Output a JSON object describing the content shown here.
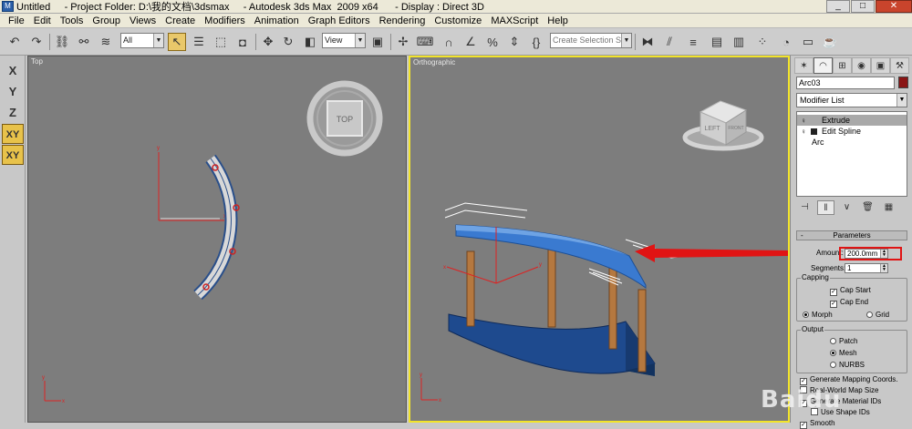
{
  "window": {
    "title": "Untitled     - Project Folder: D:\\我的文档\\3dsmax     - Autodesk 3ds Max  2009 x64      - Display : Direct 3D",
    "min": "_",
    "max": "□",
    "close": "✕"
  },
  "menu": [
    "File",
    "Edit",
    "Tools",
    "Group",
    "Views",
    "Create",
    "Modifiers",
    "Animation",
    "Graph Editors",
    "Rendering",
    "Customize",
    "MAXScript",
    "Help"
  ],
  "toolbar": {
    "filter_value": "All",
    "refcoord_value": "View",
    "selection_set_placeholder": "Create Selection Set"
  },
  "axis_constraints": [
    "X",
    "Y",
    "Z",
    "XY",
    "XY"
  ],
  "viewports": {
    "top": {
      "label": "Top",
      "viewcube": "TOP"
    },
    "ortho": {
      "label": "Orthographic",
      "viewcube_left": "LEFT",
      "viewcube_front": "FRONT"
    }
  },
  "command_panel": {
    "object_name": "Arc03",
    "object_color": "#8a1414",
    "modifier_list": "Modifier List",
    "stack": [
      "Extrude",
      "Edit Spline",
      "Arc"
    ],
    "params_title": "Parameters",
    "amount_label": "Amount:",
    "amount_value": "200.0mm",
    "segments_label": "Segments:",
    "segments_value": "1",
    "capping_label": "Capping",
    "cap_start": "Cap Start",
    "cap_end": "Cap End",
    "morph": "Morph",
    "grid": "Grid",
    "output_label": "Output",
    "patch": "Patch",
    "mesh": "Mesh",
    "nurbs": "NURBS",
    "gen_mapping": "Generate Mapping Coords.",
    "real_world": "Real-World Map Size",
    "gen_material": "Generate Material IDs",
    "use_shape": "Use Shape IDs",
    "smooth": "Smooth"
  },
  "colors": {
    "highlight": "#e01414",
    "arc_blue": "#2f6fc0",
    "post_brown": "#b07a4a",
    "active_viewport_border": "#f2e42a"
  },
  "watermark": "Baidu"
}
